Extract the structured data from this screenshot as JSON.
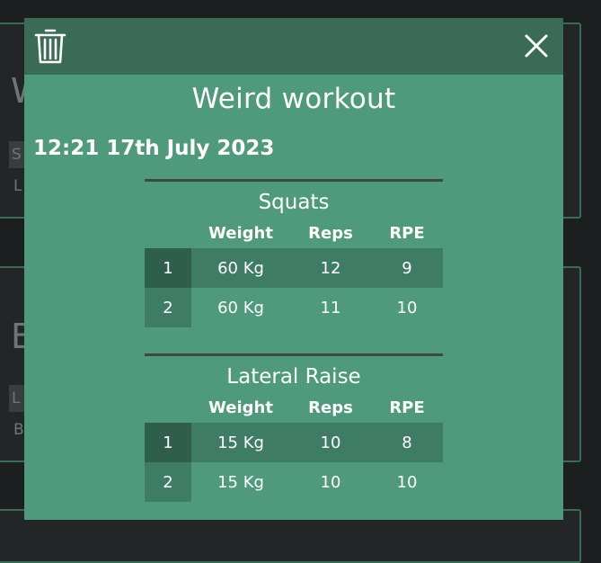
{
  "background": {
    "card1": {
      "title_fragment": "W",
      "tag": "S",
      "sub": "L"
    },
    "card2": {
      "title_fragment": "B",
      "tag": "L",
      "sub": "B"
    }
  },
  "modal": {
    "title": "Weird workout",
    "datetime": "12:21 17th July 2023",
    "header_icons": {
      "left": "trash-icon",
      "right": "close-icon"
    },
    "columns": {
      "weight": "Weight",
      "reps": "Reps",
      "rpe": "RPE"
    },
    "exercises": [
      {
        "name": "Squats",
        "sets": [
          {
            "n": "1",
            "weight": "60 Kg",
            "reps": "12",
            "rpe": "9"
          },
          {
            "n": "2",
            "weight": "60 Kg",
            "reps": "11",
            "rpe": "10"
          }
        ]
      },
      {
        "name": "Lateral Raise",
        "sets": [
          {
            "n": "1",
            "weight": "15 Kg",
            "reps": "10",
            "rpe": "8"
          },
          {
            "n": "2",
            "weight": "15 Kg",
            "reps": "10",
            "rpe": "10"
          }
        ]
      }
    ]
  },
  "colors": {
    "modal_bg": "#4f9a7c",
    "header_bg": "#3a6b57",
    "page_bg": "#1c1f20",
    "card_border": "#3b6b56"
  }
}
